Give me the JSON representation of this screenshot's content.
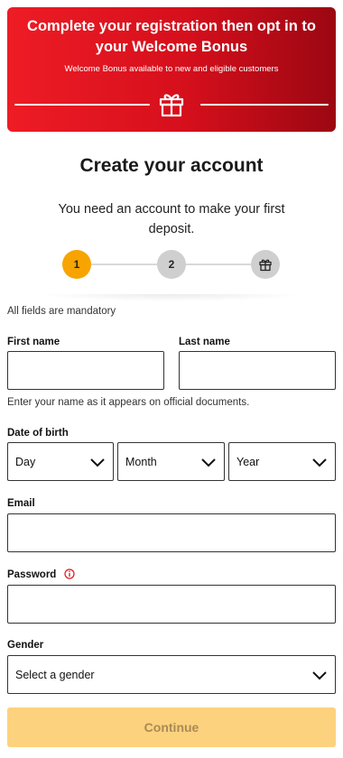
{
  "banner": {
    "title": "Complete your registration then opt in to your Welcome Bonus",
    "subtitle": "Welcome Bonus available to new and eligible customers",
    "icon": "gift-icon"
  },
  "page": {
    "title": "Create your account",
    "subtitle": "You need an account to make your first deposit."
  },
  "stepper": {
    "steps": [
      {
        "label": "1",
        "state": "active",
        "color": "#f7a400"
      },
      {
        "label": "2",
        "state": "pending",
        "color": "#cfcfcf"
      },
      {
        "icon": "gift-icon",
        "state": "pending",
        "color": "#cfcfcf"
      }
    ]
  },
  "form": {
    "mandatory_note": "All fields are mandatory",
    "first_name": {
      "label": "First name",
      "value": ""
    },
    "last_name": {
      "label": "Last name",
      "value": ""
    },
    "name_hint": "Enter your name as it appears on official documents.",
    "dob": {
      "label": "Date of birth",
      "day": "Day",
      "month": "Month",
      "year": "Year"
    },
    "email": {
      "label": "Email",
      "value": ""
    },
    "password": {
      "label": "Password",
      "value": "",
      "info_icon": "info-icon"
    },
    "gender": {
      "label": "Gender",
      "value": "Select a gender"
    },
    "continue_label": "Continue"
  },
  "colors": {
    "banner_red": "#ee1c25",
    "accent_orange": "#f7a400",
    "button_disabled": "#fdd27e"
  }
}
